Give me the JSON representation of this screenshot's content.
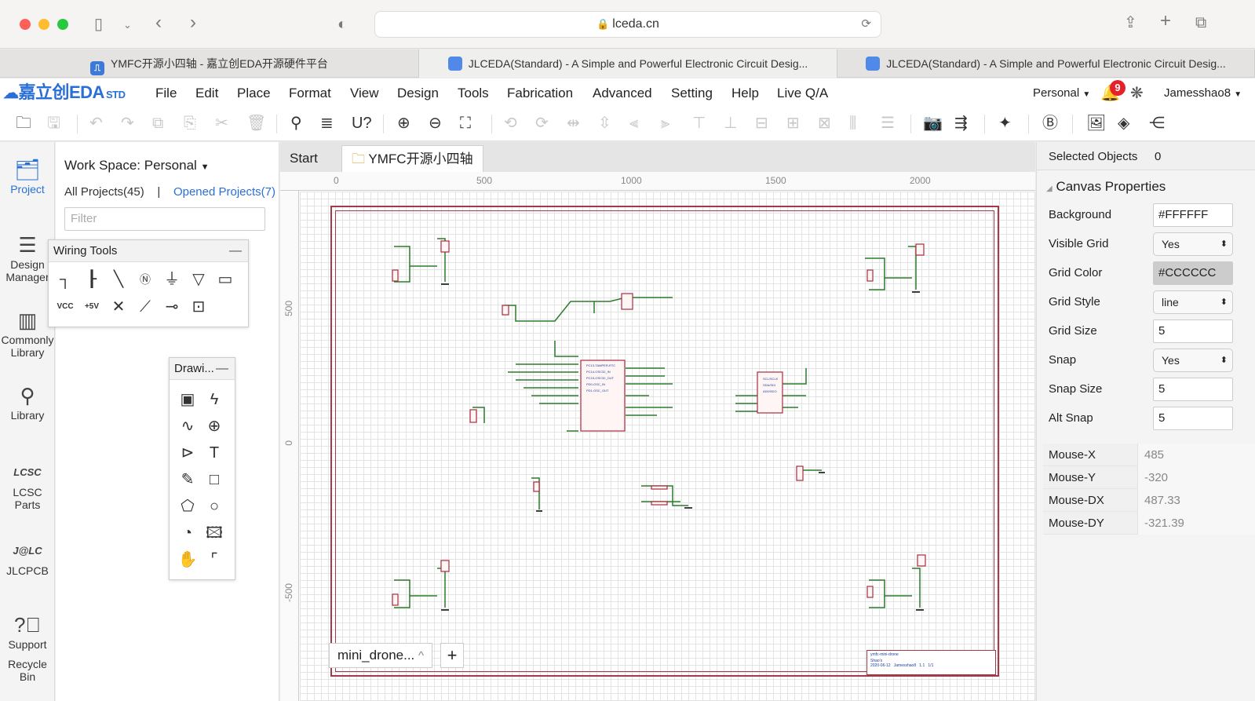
{
  "browser": {
    "url": "lceda.cn",
    "tabs": [
      {
        "title": "YMFC开源小四轴 - 嘉立创EDA开源硬件平台",
        "favicon": "jlc-favicon-icon"
      },
      {
        "title": "JLCEDA(Standard) - A Simple and Powerful Electronic Circuit Desig...",
        "favicon": "cloud-favicon-icon"
      },
      {
        "title": "JLCEDA(Standard) - A Simple and Powerful Electronic Circuit Desig...",
        "favicon": "cloud-favicon-icon"
      }
    ]
  },
  "app": {
    "logo_text": "嘉立创EDA",
    "logo_suffix": "STD",
    "menu": [
      "File",
      "Edit",
      "Place",
      "Format",
      "View",
      "Design",
      "Tools",
      "Fabrication",
      "Advanced",
      "Setting",
      "Help",
      "Live Q/A"
    ],
    "account_type": "Personal",
    "notification_count": "9",
    "username": "Jamesshao8"
  },
  "left_rail": [
    {
      "label": "Project",
      "icon": "folder-icon"
    },
    {
      "label": "Design Manager",
      "icon": "list-icon"
    },
    {
      "label": "Commonly Library",
      "icon": "chip-icon"
    },
    {
      "label": "Library",
      "icon": "magnifier-icon"
    },
    {
      "label": "LCSC Parts",
      "icon": "lcsc-icon"
    },
    {
      "label": "JLCPCB",
      "icon": "jlc-icon"
    },
    {
      "label": "Support",
      "icon": "question-icon"
    },
    {
      "label": "Recycle Bin",
      "icon": "trash-icon"
    }
  ],
  "project_panel": {
    "workspace": "Work Space: Personal",
    "all_projects": "All Projects(45)",
    "separator": "|",
    "opened_projects": "Opened Projects(7)",
    "filter_placeholder": "Filter"
  },
  "wiring_tools": {
    "title": "Wiring Tools",
    "minimize": "—",
    "vcc_label": "VCC",
    "p5v_label": "+5V"
  },
  "drawing_tools": {
    "title": "Drawi...",
    "minimize": "—"
  },
  "doc_tabs": {
    "start": "Start",
    "active": "YMFC开源小四轴"
  },
  "rulers": {
    "h": [
      "0",
      "500",
      "1000",
      "1500",
      "2000"
    ],
    "v": [
      "500",
      "0",
      "-500"
    ]
  },
  "sheet": {
    "name": "mini_drone...",
    "chevron": "^",
    "add": "+"
  },
  "title_block": {
    "title": "ymfc-mini-drone",
    "company": "Shao's",
    "date": "2020-06-12",
    "drawn_by": "Jamesshao8",
    "rev": "1.1",
    "sheet": "1/1"
  },
  "props": {
    "selected_label": "Selected Objects",
    "selected_count": "0",
    "section": "Canvas Properties",
    "rows": [
      {
        "label": "Background",
        "value": "#FFFFFF",
        "kind": "input"
      },
      {
        "label": "Visible Grid",
        "value": "Yes",
        "kind": "select"
      },
      {
        "label": "Grid Color",
        "value": "#CCCCCC",
        "kind": "color"
      },
      {
        "label": "Grid Style",
        "value": "line",
        "kind": "select"
      },
      {
        "label": "Grid Size",
        "value": "5",
        "kind": "input"
      },
      {
        "label": "Snap",
        "value": "Yes",
        "kind": "select"
      },
      {
        "label": "Snap Size",
        "value": "5",
        "kind": "input"
      },
      {
        "label": "Alt Snap",
        "value": "5",
        "kind": "input"
      }
    ],
    "mouse": [
      {
        "label": "Mouse-X",
        "value": "485"
      },
      {
        "label": "Mouse-Y",
        "value": "-320"
      },
      {
        "label": "Mouse-DX",
        "value": "487.33"
      },
      {
        "label": "Mouse-DY",
        "value": "-321.39"
      }
    ]
  },
  "colors": {
    "accent": "#2a6fd6",
    "frame": "#a23a48",
    "wire": "#2c7a2c",
    "component": "#a82c3c"
  }
}
